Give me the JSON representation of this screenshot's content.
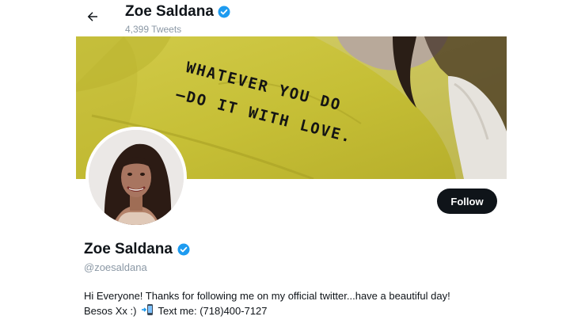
{
  "header": {
    "name": "Zoe Saldana",
    "tweet_count": "4,399 Tweets"
  },
  "banner": {
    "shirt_text_line1": "WHATEVER YOU DO",
    "shirt_text_line2": "—DO IT WITH LOVE."
  },
  "actions": {
    "follow_label": "Follow"
  },
  "profile": {
    "name": "Zoe Saldana",
    "handle": "@zoesaldana",
    "bio_line1": "Hi Everyone! Thanks for following me on my official twitter...have a beautiful day!",
    "bio_line2_prefix": "Besos Xx :)",
    "bio_line2_suffix": "Text me: (718)400-7127"
  },
  "colors": {
    "verified": "#1d9bf0",
    "follow_button_bg": "#0f1419",
    "banner_yellow": "#c9c23c",
    "secondary_text": "#8b98a5"
  },
  "icons": {
    "back": "arrow-left-icon",
    "verified": "verified-badge-icon",
    "phone": "mobile-phone-icon"
  }
}
